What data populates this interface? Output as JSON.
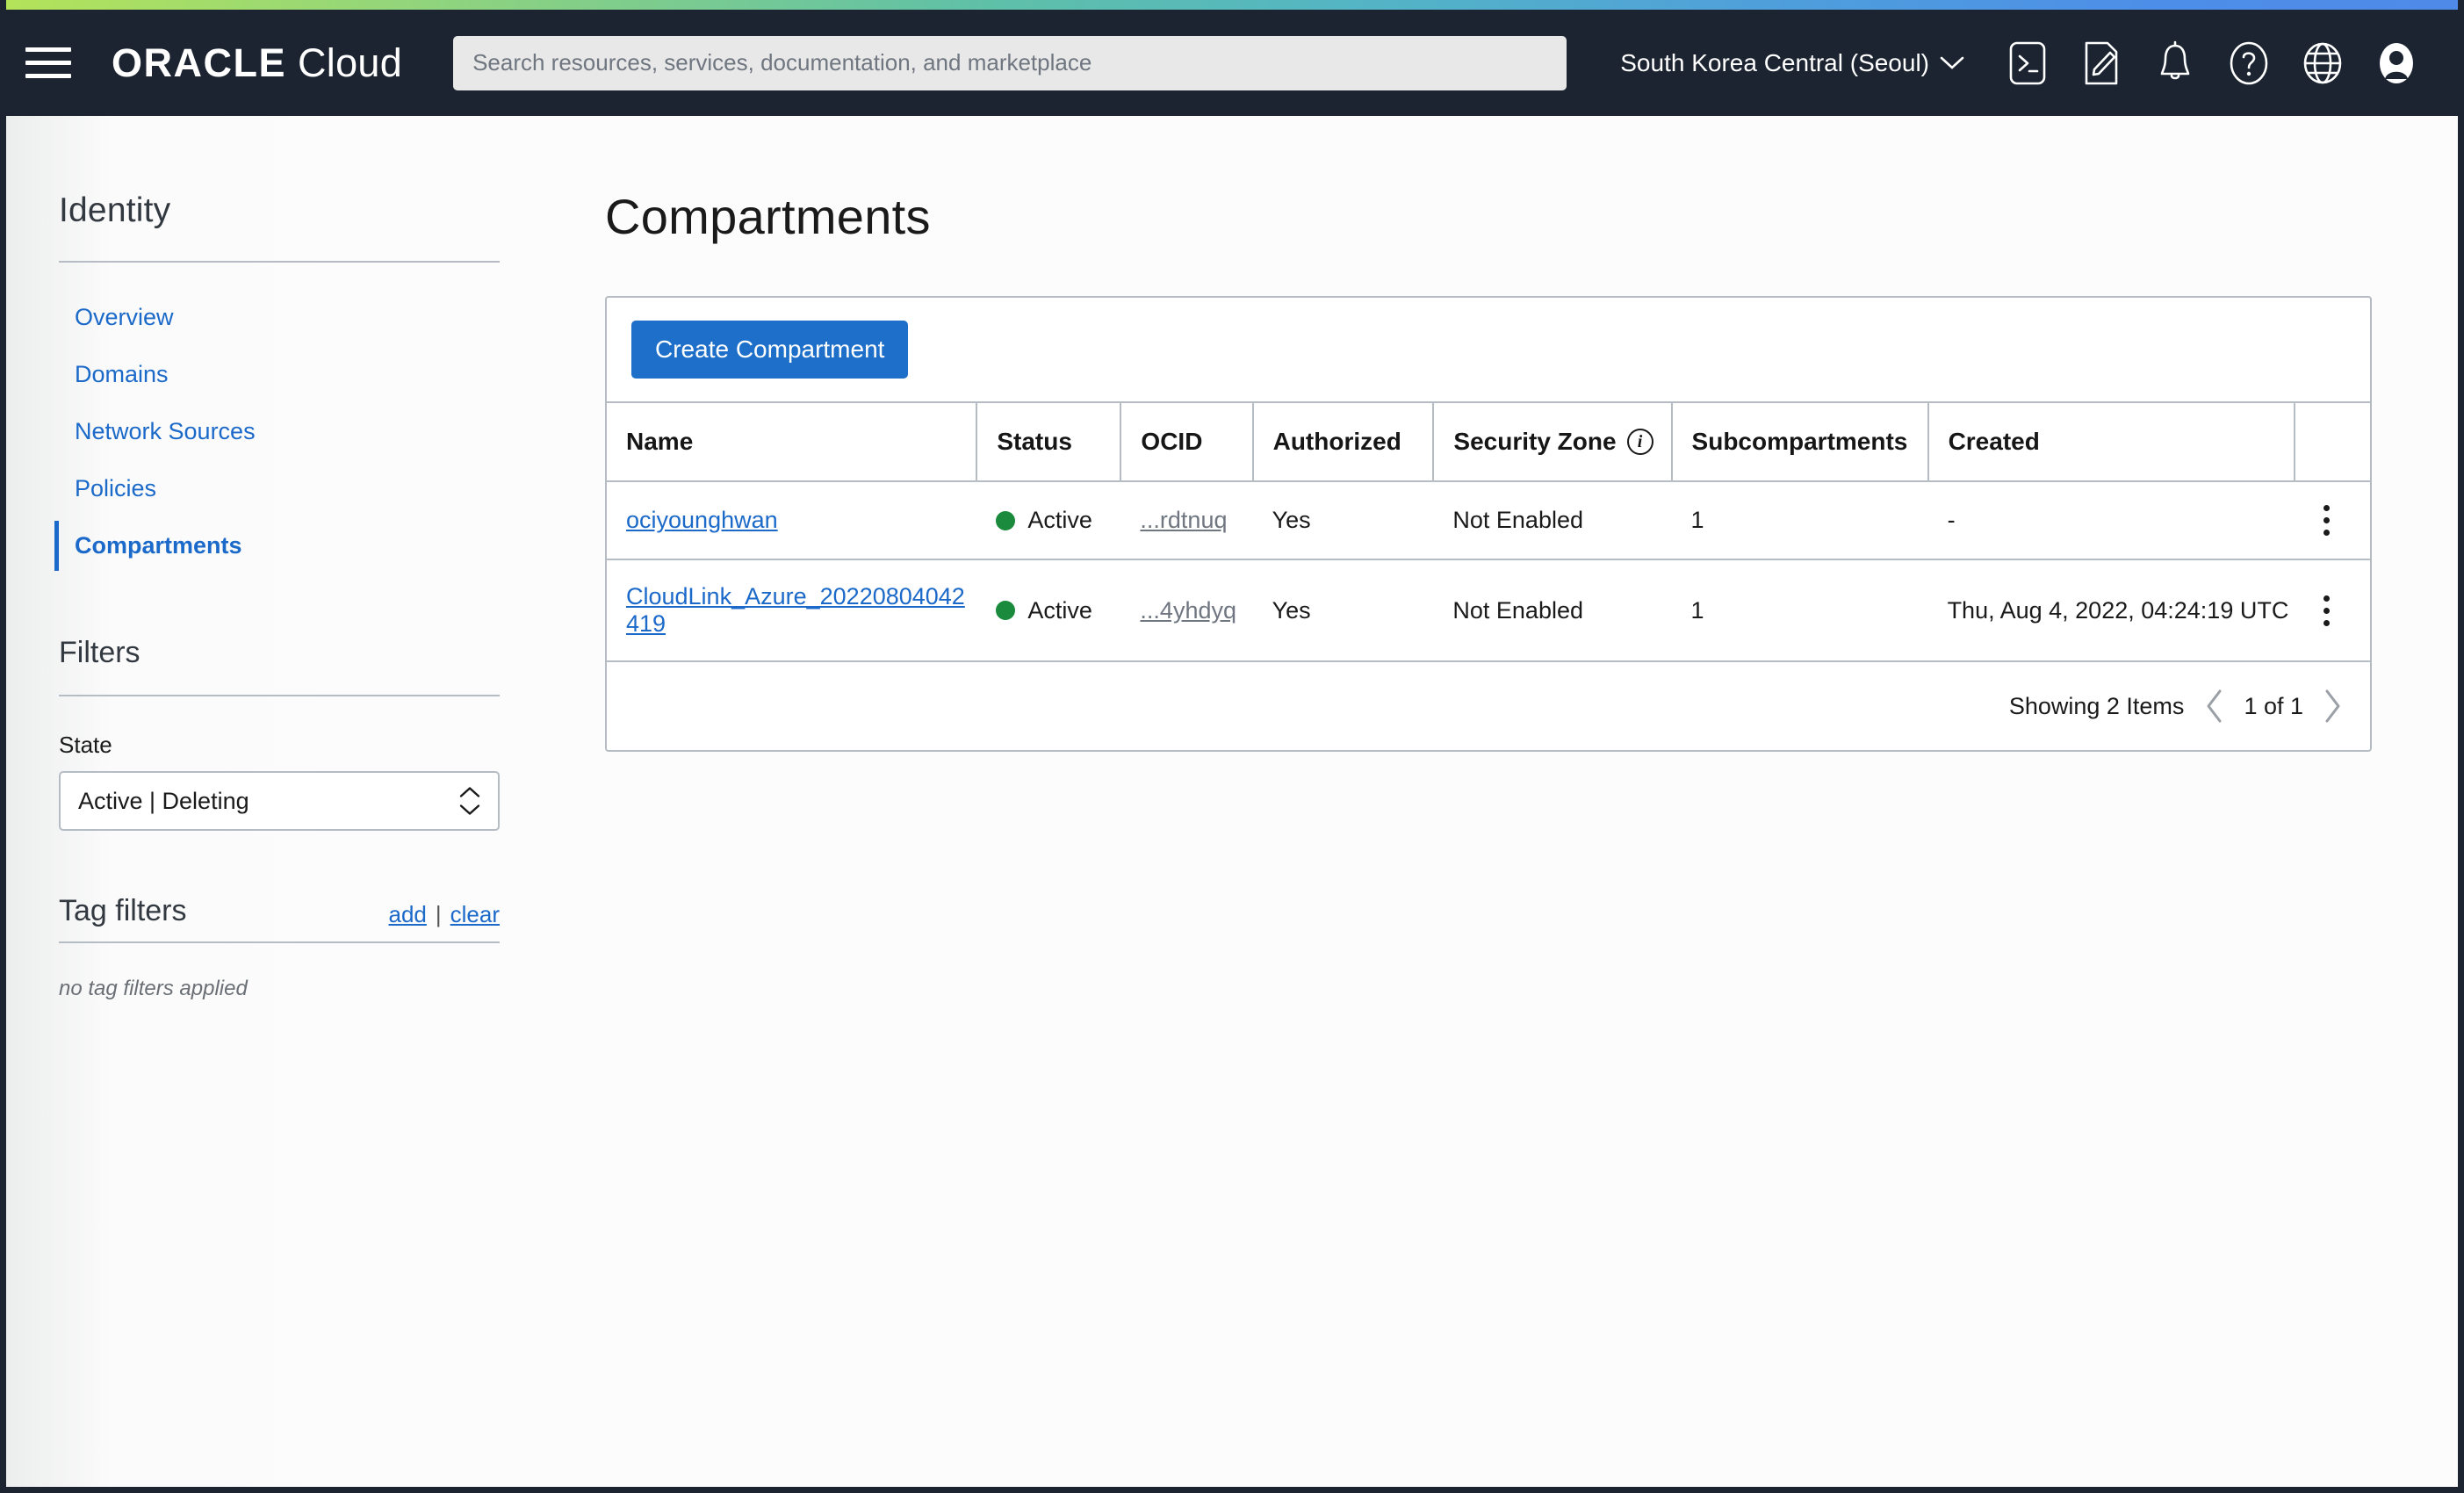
{
  "topbar": {
    "brand_oracle": "ORACLE",
    "brand_cloud": "Cloud",
    "search_placeholder": "Search resources, services, documentation, and marketplace",
    "search_value": "",
    "region": "South Korea Central (Seoul)",
    "icons": [
      "cloud-shell-icon",
      "edit-icon",
      "notifications-bell-icon",
      "help-icon",
      "language-globe-icon",
      "user-avatar-icon"
    ]
  },
  "sidebar": {
    "heading": "Identity",
    "items": [
      {
        "label": "Overview",
        "active": false
      },
      {
        "label": "Domains",
        "active": false
      },
      {
        "label": "Network Sources",
        "active": false
      },
      {
        "label": "Policies",
        "active": false
      },
      {
        "label": "Compartments",
        "active": true
      }
    ],
    "filters_heading": "Filters",
    "state_label": "State",
    "state_value": "Active | Deleting",
    "tag_filters_heading": "Tag filters",
    "tag_add": "add",
    "tag_sep": "|",
    "tag_clear": "clear",
    "no_tag_filters": "no tag filters applied"
  },
  "main": {
    "title": "Compartments",
    "create_button": "Create Compartment",
    "columns": [
      "Name",
      "Status",
      "OCID",
      "Authorized",
      "Security Zone",
      "Subcompartments",
      "Created"
    ],
    "security_zone_info": "i",
    "rows": [
      {
        "name": "ociyounghwan",
        "status": "Active",
        "ocid": "...rdtnuq",
        "authorized": "Yes",
        "security_zone": "Not Enabled",
        "subcompartments": "1",
        "created": "-"
      },
      {
        "name": "CloudLink_Azure_20220804042419",
        "status": "Active",
        "ocid": "...4yhdyq",
        "authorized": "Yes",
        "security_zone": "Not Enabled",
        "subcompartments": "1",
        "created": "Thu, Aug 4, 2022, 04:24:19 UTC"
      }
    ],
    "footer": {
      "showing": "Showing 2 Items",
      "page_text": "1 of 1",
      "prev_icon": "chevron-left-icon",
      "next_icon": "chevron-right-icon"
    }
  },
  "colors": {
    "accent_blue": "#1d6fc9",
    "link_blue": "#1b69c9",
    "navbar_dark": "#1b2430",
    "status_green": "#1a8a3c"
  }
}
